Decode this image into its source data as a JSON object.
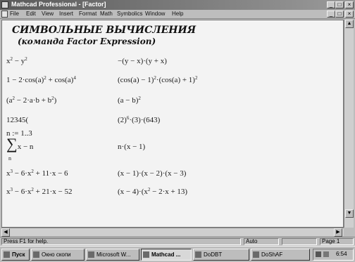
{
  "window": {
    "title": "Mathcad Professional - [Factor]"
  },
  "menu": [
    "File",
    "Edit",
    "View",
    "Insert",
    "Format",
    "Math",
    "Symbolics",
    "Window",
    "Help"
  ],
  "document": {
    "heading1": "СИМВОЛЬНЫЕ  ВЫЧИСЛЕНИЯ",
    "heading2": "(команда Factor  Expression)",
    "rows": [
      {
        "lhs_pre": "x",
        "lhs_sup": "2",
        "lhs_mid": " − y",
        "lhs_sup2": "2",
        "lhs_post": "",
        "rhs_pre": "−(y − x)·(y + x)",
        "rhs_sup": "",
        "rhs_post": ""
      },
      {
        "lhs_pre": "1 − 2·cos(a)",
        "lhs_sup": "2",
        "lhs_mid": " + cos(a)",
        "lhs_sup2": "4",
        "lhs_post": "",
        "rhs_pre": "(cos(a) − 1)",
        "rhs_sup": "2",
        "rhs_post": "·(cos(a) + 1)",
        "rhs_sup2": "2"
      },
      {
        "lhs_pre": "(a",
        "lhs_sup": "2",
        "lhs_mid": " − 2·a·b + b",
        "lhs_sup2": "2",
        "lhs_post": ")",
        "rhs_pre": "(a − b)",
        "rhs_sup": "2",
        "rhs_post": ""
      },
      {
        "lhs_pre": "12345(",
        "lhs_sup": "",
        "lhs_mid": "",
        "lhs_sup2": "",
        "lhs_post": "",
        "rhs_pre": "(2)",
        "rhs_sup": "6",
        "rhs_post": "·(3)·(643)"
      },
      {
        "lhs_pre": "n := 1..3",
        "lhs_sup": "",
        "lhs_mid": "",
        "lhs_sup2": "",
        "lhs_post": "",
        "rhs_pre": "",
        "rhs_sup": "",
        "rhs_post": ""
      },
      {
        "sigma": "∑",
        "lhs_pre": "x − n",
        "sub": "n",
        "rhs_pre": "n·(x − 1)",
        "rhs_sup": "",
        "rhs_post": ""
      },
      {
        "lhs_pre": "x",
        "lhs_sup": "3",
        "lhs_mid": " − 6·x",
        "lhs_sup2": "2",
        "lhs_post": " + 11·x − 6",
        "rhs_pre": "(x − 1)·(x − 2)·(x − 3)",
        "rhs_sup": "",
        "rhs_post": ""
      },
      {
        "lhs_pre": "x",
        "lhs_sup": "3",
        "lhs_mid": " − 6·x",
        "lhs_sup2": "2",
        "lhs_post": " + 21·x − 52",
        "rhs_pre": "(x − 4)·(x",
        "rhs_sup": "2",
        "rhs_post": " − 2·x + 13)"
      }
    ]
  },
  "statusbar": {
    "help": "Press F1 for help.",
    "mode": "Auto",
    "page": "Page 1"
  },
  "taskbar": {
    "start": "Пуск",
    "items": [
      "Окно скопи",
      "Microsoft W...",
      "Mathcad ...",
      "DoDBT",
      "DoShAF"
    ],
    "clock": "6:54"
  }
}
